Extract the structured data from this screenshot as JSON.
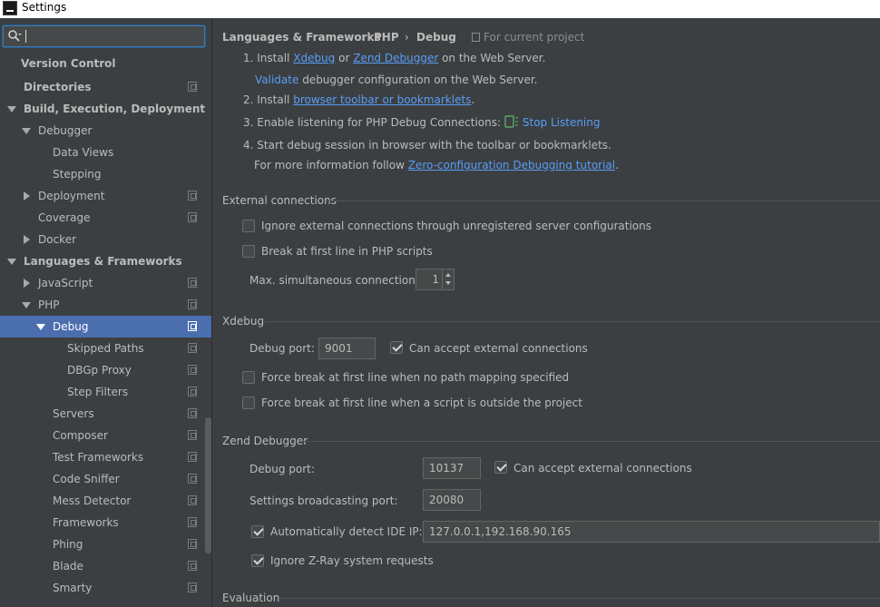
{
  "window": {
    "title": "Settings"
  },
  "sidebar": {
    "search_value": "",
    "items": [
      {
        "label": "Version Control"
      },
      {
        "label": "Directories"
      },
      {
        "label": "Build, Execution, Deployment"
      },
      {
        "label": "Debugger"
      },
      {
        "label": "Data Views"
      },
      {
        "label": "Stepping"
      },
      {
        "label": "Deployment"
      },
      {
        "label": "Coverage"
      },
      {
        "label": "Docker"
      },
      {
        "label": "Languages & Frameworks"
      },
      {
        "label": "JavaScript"
      },
      {
        "label": "PHP"
      },
      {
        "label": "Debug"
      },
      {
        "label": "Skipped Paths"
      },
      {
        "label": "DBGp Proxy"
      },
      {
        "label": "Step Filters"
      },
      {
        "label": "Servers"
      },
      {
        "label": "Composer"
      },
      {
        "label": "Test Frameworks"
      },
      {
        "label": "Code Sniffer"
      },
      {
        "label": "Mess Detector"
      },
      {
        "label": "Frameworks"
      },
      {
        "label": "Phing"
      },
      {
        "label": "Blade"
      },
      {
        "label": "Smarty"
      }
    ]
  },
  "breadcrumb": {
    "part1": "Languages & Frameworks",
    "part2": "PHP",
    "part3": "Debug",
    "separator": "›",
    "note": "For current project"
  },
  "instructions": {
    "step1_prefix": "1. Install",
    "step1_link1": "Xdebug",
    "step1_or": "or",
    "step1_link2": "Zend Debugger",
    "step1_suffix": "on the Web Server.",
    "validate_link": "Validate",
    "validate_suffix": "debugger configuration on the Web Server.",
    "step2_prefix": "2. Install",
    "step2_link": "browser toolbar or bookmarklets",
    "step2_suffix": ".",
    "step3_text": "3. Enable listening for PHP Debug Connections:",
    "step3_link": "Stop Listening",
    "step4_text": "4. Start debug session in browser with the toolbar or bookmarklets.",
    "more_prefix": "For more information follow",
    "more_link": "Zero-configuration Debugging tutorial",
    "more_suffix": "."
  },
  "external": {
    "title": "External connections",
    "ignore_label": "Ignore external connections through unregistered server configurations",
    "ignore_checked": false,
    "break_label": "Break at first line in PHP scripts",
    "break_checked": false,
    "max_label": "Max. simultaneous connections:",
    "max_value": "1"
  },
  "xdebug": {
    "title": "Xdebug",
    "port_label": "Debug port:",
    "port_value": "9001",
    "accept_label": "Can accept external connections",
    "accept_checked": true,
    "force_mapping_label": "Force break at first line when no path mapping specified",
    "force_mapping_checked": false,
    "force_outside_label": "Force break at first line when a script is outside the project",
    "force_outside_checked": false
  },
  "zend": {
    "title": "Zend Debugger",
    "port_label": "Debug port:",
    "port_value": "10137",
    "accept_label": "Can accept external connections",
    "accept_checked": true,
    "broadcast_label": "Settings broadcasting port:",
    "broadcast_value": "20080",
    "detect_label": "Automatically detect IDE IP:",
    "detect_checked": true,
    "ip_value": "127.0.0.1,192.168.90.165",
    "zray_label": "Ignore Z-Ray system requests",
    "zray_checked": true
  },
  "evaluation": {
    "title": "Evaluation"
  },
  "colors": {
    "accent": "#4b6eaf",
    "link": "#589df6",
    "background": "#3c3f41"
  }
}
